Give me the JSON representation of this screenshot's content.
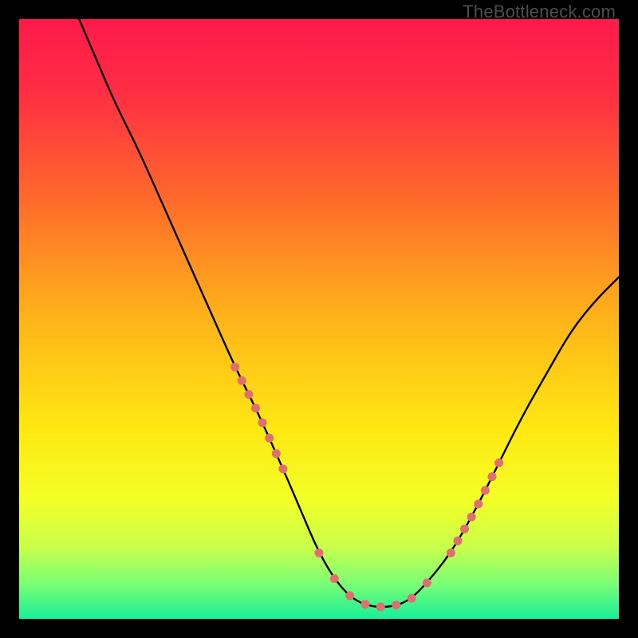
{
  "watermark": "TheBottleneck.com",
  "chart_data": {
    "type": "line",
    "title": "",
    "xlabel": "",
    "ylabel": "",
    "xlim": [
      0,
      100
    ],
    "ylim": [
      0,
      100
    ],
    "gradient_stops": [
      {
        "offset": 0.0,
        "color": "#ff1a4b"
      },
      {
        "offset": 0.12,
        "color": "#ff2d44"
      },
      {
        "offset": 0.3,
        "color": "#ff6a2b"
      },
      {
        "offset": 0.5,
        "color": "#ffb41a"
      },
      {
        "offset": 0.68,
        "color": "#ffe712"
      },
      {
        "offset": 0.8,
        "color": "#f3ff26"
      },
      {
        "offset": 0.88,
        "color": "#c9ff4a"
      },
      {
        "offset": 0.94,
        "color": "#7dff74"
      },
      {
        "offset": 1.0,
        "color": "#18ee9a"
      }
    ],
    "series": [
      {
        "name": "bottleneck-curve",
        "color": "#000000",
        "x": [
          10,
          13,
          16,
          20,
          24,
          28,
          32,
          36,
          40,
          44,
          47,
          50,
          53,
          56,
          59,
          62,
          65,
          68,
          72,
          76,
          80,
          84,
          88,
          92,
          96,
          100
        ],
        "values": [
          100,
          93,
          86,
          78,
          69,
          60,
          51,
          42,
          34,
          25,
          18,
          11,
          6,
          3,
          2,
          2,
          3,
          6,
          11,
          18,
          26,
          34,
          41,
          48,
          53,
          57
        ]
      }
    ],
    "marker_segments": [
      {
        "x_range": [
          36,
          44
        ],
        "value_range": [
          42,
          25
        ],
        "color": "#e07070"
      },
      {
        "x_range": [
          50,
          68
        ],
        "value_range": [
          11,
          6
        ],
        "color": "#e07070"
      },
      {
        "x_range": [
          72,
          80
        ],
        "value_range": [
          11,
          26
        ],
        "color": "#e07070"
      }
    ]
  }
}
